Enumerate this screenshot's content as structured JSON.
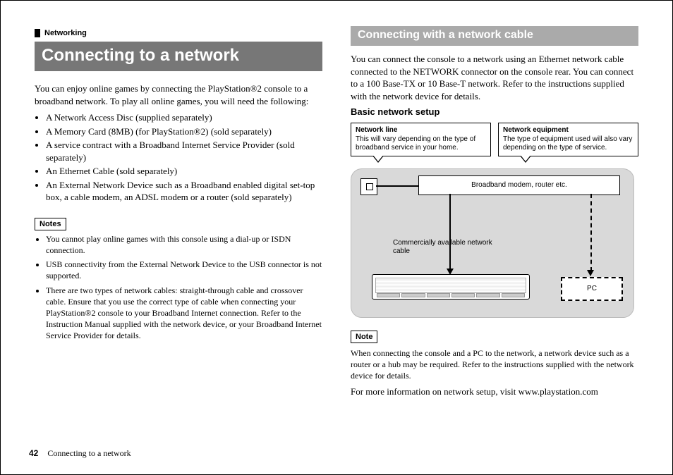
{
  "page_number": "42",
  "footer_title": "Connecting to a network",
  "left": {
    "section_tag": "Networking",
    "heading": "Connecting to a network",
    "intro": "You can enjoy online games by connecting the PlayStation®2 console to a broadband network. To play all online games, you will need the following:",
    "bullets": [
      "A Network Access Disc (supplied separately)",
      "A Memory Card (8MB) (for PlayStation®2) (sold separately)",
      "A service contract with a Broadband Internet Service Provider (sold separately)",
      "An Ethernet Cable (sold separately)",
      "An External Network Device such as a Broadband enabled digital set-top box, a cable modem, an ADSL modem or a router (sold separately)"
    ],
    "notes_label": "Notes",
    "notes": [
      "You cannot play online games with this console using a dial-up or ISDN connection.",
      "USB connectivity from the External Network Device to the USB connector is not supported.",
      "There are two types of network cables: straight-through cable and crossover cable. Ensure that you use the correct type of cable when connecting your PlayStation®2 console to your Broadband Internet connection. Refer to the Instruction Manual supplied with the network device, or your Broadband Internet Service Provider for details."
    ]
  },
  "right": {
    "heading": "Connecting with a network cable",
    "intro": "You can connect the console to a network using an Ethernet network cable connected to the NETWORK connector on the console rear. You can connect to a 100 Base-TX or 10 Base-T network. Refer to the instructions supplied with the network device for details.",
    "h3": "Basic network setup",
    "callout1_title": "Network line",
    "callout1_body": "This will vary depending on the type of broadband service in your home.",
    "callout2_title": "Network equipment",
    "callout2_body": "The type of equipment used will also vary depending on the type of service.",
    "diagram": {
      "modem_label": "Broadband modem, router etc.",
      "cable_label": "Commercially available network cable",
      "pc_label": "PC"
    },
    "note_label": "Note",
    "note_body": "When connecting the console and a PC to the network, a network device such as a router or a hub may be required. Refer to the instructions supplied with the network device for details.",
    "more_info": "For more information on network setup, visit www.playstation.com"
  }
}
